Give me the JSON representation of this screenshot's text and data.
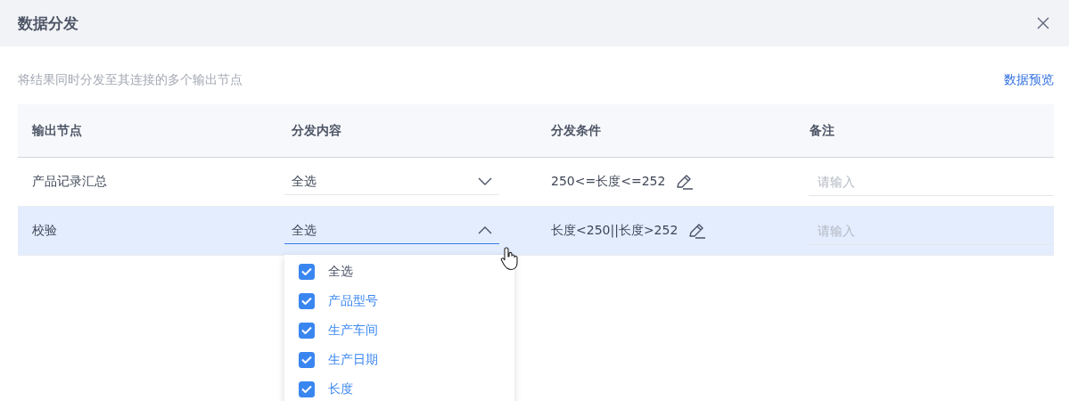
{
  "dialog": {
    "title": "数据分发",
    "description": "将结果同时分发至其连接的多个输出节点",
    "preview_link": "数据预览"
  },
  "table": {
    "columns": [
      "输出节点",
      "分发内容",
      "分发条件",
      "备注"
    ],
    "rows": [
      {
        "node": "产品记录汇总",
        "content": "全选",
        "expanded": false,
        "selected": false,
        "condition": "250<=长度<=252",
        "remark_placeholder": "请输入"
      },
      {
        "node": "校验",
        "content": "全选",
        "expanded": true,
        "selected": true,
        "condition": "长度<250||长度>252",
        "remark_placeholder": "请输入",
        "options": [
          {
            "label": "全选",
            "checked": true,
            "selected": false
          },
          {
            "label": "产品型号",
            "checked": true,
            "selected": true
          },
          {
            "label": "生产车间",
            "checked": true,
            "selected": true
          },
          {
            "label": "生产日期",
            "checked": true,
            "selected": true
          },
          {
            "label": "长度",
            "checked": true,
            "selected": true
          }
        ]
      }
    ]
  }
}
